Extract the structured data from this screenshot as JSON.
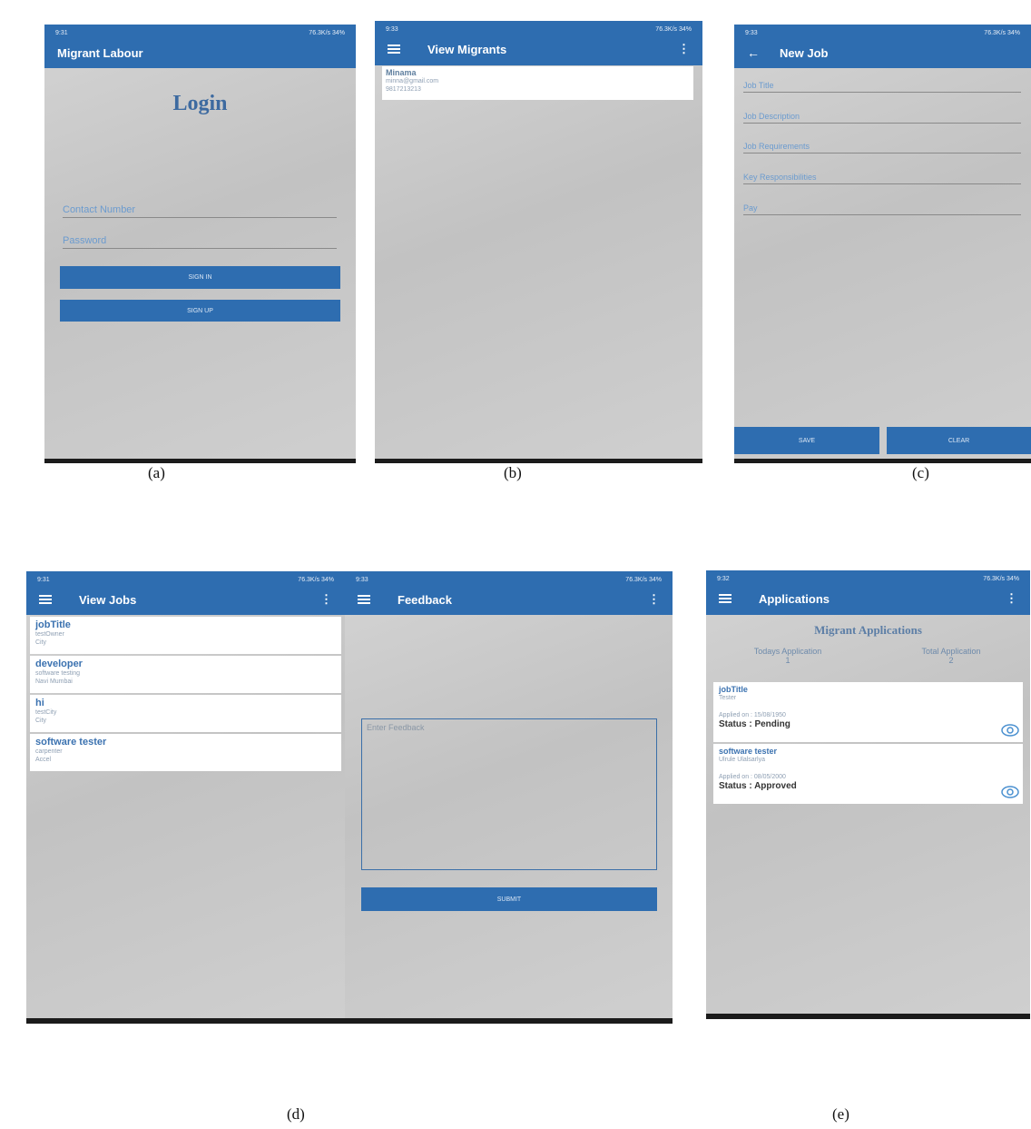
{
  "captions": [
    "(a)",
    "(b)",
    "(c)",
    "(d)",
    "(e)"
  ],
  "status_bar": {
    "a_time": "9:31",
    "b_time": "9:33",
    "c_time": "9:33",
    "d1_time": "9:31",
    "d2_time": "9:33",
    "e_time": "9:32",
    "right": "76.3K/s 34%"
  },
  "login": {
    "app_title": "Migrant Labour",
    "heading": "Login",
    "contact_placeholder": "Contact Number",
    "password_placeholder": "Password",
    "signin_label": "SIGN IN",
    "signup_label": "SIGN UP"
  },
  "view_migrants": {
    "title": "View Migrants",
    "item": {
      "name": "Minama",
      "email": "minna@gmail.com",
      "phone": "9817213213"
    }
  },
  "new_job": {
    "title": "New Job",
    "fields": [
      "Job Title",
      "Job Description",
      "Job Requirements",
      "Key Responsibilities",
      "Pay"
    ],
    "save_label": "SAVE",
    "clear_label": "CLEAR"
  },
  "view_jobs": {
    "title": "View Jobs",
    "items": [
      {
        "title": "jobTitle",
        "line1": "testOwner",
        "line2": "City"
      },
      {
        "title": "developer",
        "line1": "software testing",
        "line2": "Navi Mumbai"
      },
      {
        "title": "hi",
        "line1": "testCity",
        "line2": "City"
      },
      {
        "title": "software tester",
        "line1": "carpenter",
        "line2": "Accel"
      }
    ]
  },
  "feedback": {
    "title": "Feedback",
    "placeholder": "Enter Feedback",
    "submit_label": "SUBMIT"
  },
  "applications": {
    "title": "Applications",
    "heading": "Migrant Applications",
    "today_label": "Todays Application",
    "today_value": "1",
    "total_label": "Total Application",
    "total_value": "2",
    "items": [
      {
        "title": "jobTitle",
        "sub": "Tester",
        "applied": "Applied on : 15/08/1950",
        "status": "Status : Pending"
      },
      {
        "title": "software tester",
        "sub": "Ulrule Ulalsarlya",
        "applied": "Applied on : 08/05/2000",
        "status": "Status : Approved"
      }
    ]
  }
}
